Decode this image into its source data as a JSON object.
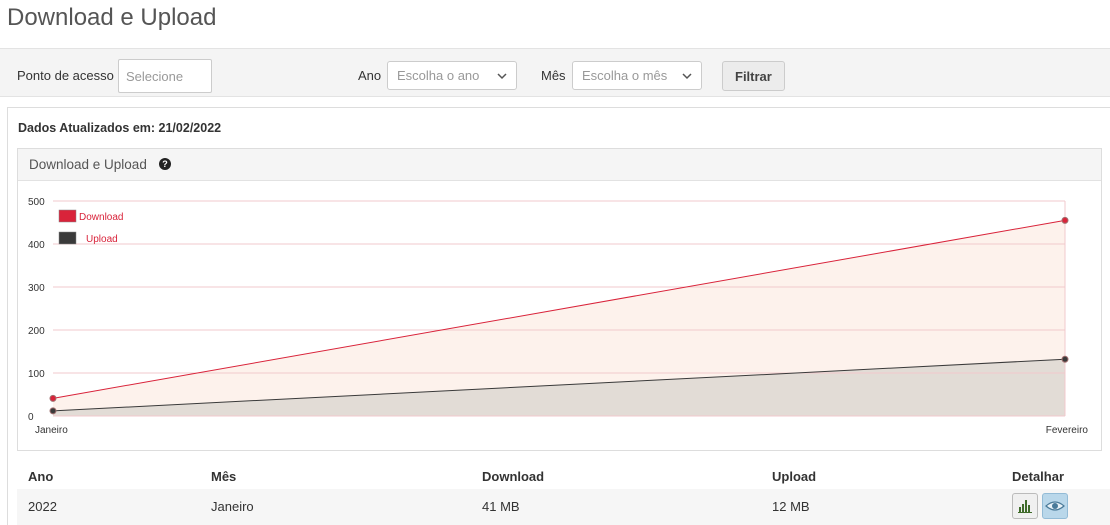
{
  "page": {
    "title": "Download e Upload"
  },
  "filters": {
    "ponto_label": "Ponto de acesso",
    "ponto_placeholder": "Selecione",
    "ano_label": "Ano",
    "ano_value": "Escolha o ano",
    "mes_label": "Mês",
    "mes_value": "Escolha o mês",
    "filter_button": "Filtrar"
  },
  "updated_text": "Dados Atualizados em: 21/02/2022",
  "chart_panel": {
    "title": "Download e Upload",
    "help_icon": "?"
  },
  "chart_data": {
    "type": "area",
    "categories": [
      "Janeiro",
      "Fevereiro"
    ],
    "series": [
      {
        "name": "Download",
        "values": [
          41,
          455
        ],
        "color": "#d9233a",
        "fill": "#fdf2ec"
      },
      {
        "name": "Upload",
        "values": [
          12,
          132
        ],
        "color": "#3a3a3a",
        "fill": "#e2dcd6"
      }
    ],
    "ylim": [
      0,
      500
    ],
    "yticks": [
      0,
      100,
      200,
      300,
      400,
      500
    ],
    "grid": true,
    "legend": "top-left"
  },
  "table": {
    "headers": [
      "Ano",
      "Mês",
      "Download",
      "Upload",
      "Detalhar"
    ],
    "rows": [
      {
        "ano": "2022",
        "mes": "Janeiro",
        "download": "41 MB",
        "upload": "12 MB"
      }
    ],
    "row_icons": [
      "bar-chart-icon",
      "eye-icon"
    ]
  }
}
